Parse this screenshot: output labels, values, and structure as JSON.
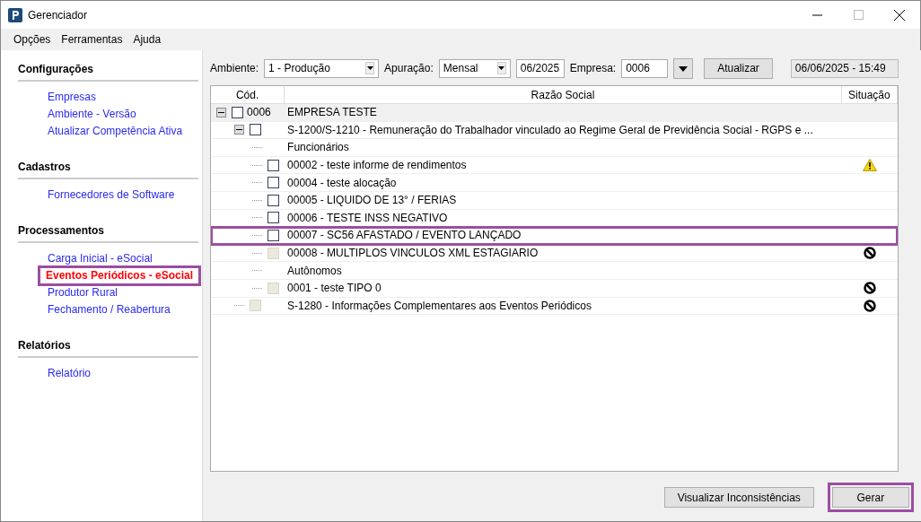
{
  "window": {
    "title": "Gerenciador"
  },
  "menu": [
    "Opções",
    "Ferramentas",
    "Ajuda"
  ],
  "sidebar": {
    "sections": [
      {
        "title": "Configurações",
        "items": [
          {
            "label": "Empresas",
            "selected": false,
            "highlighted": false
          },
          {
            "label": "Ambiente - Versão",
            "selected": false,
            "highlighted": false
          },
          {
            "label": "Atualizar Competência Ativa",
            "selected": false,
            "highlighted": false
          }
        ]
      },
      {
        "title": "Cadastros",
        "items": [
          {
            "label": "Fornecedores de Software",
            "selected": false,
            "highlighted": false
          }
        ]
      },
      {
        "title": "Processamentos",
        "items": [
          {
            "label": "Carga Inicial - eSocial",
            "selected": false,
            "highlighted": false
          },
          {
            "label": "Eventos Periódicos - eSocial",
            "selected": true,
            "highlighted": true
          },
          {
            "label": "Produtor Rural",
            "selected": false,
            "highlighted": false
          },
          {
            "label": "Fechamento / Reabertura",
            "selected": false,
            "highlighted": false
          }
        ]
      },
      {
        "title": "Relatórios",
        "items": [
          {
            "label": "Relatório",
            "selected": false,
            "highlighted": false
          }
        ]
      }
    ]
  },
  "toolbar": {
    "ambiente_label": "Ambiente:",
    "ambiente": "1 - Produção",
    "apuracao_label": "Apuração:",
    "apuracao": "Mensal",
    "periodo": "06/2025",
    "empresa_label": "Empresa:",
    "empresa": "0006",
    "refresh_button": "Atualizar",
    "timestamp": "06/06/2025 - 15:49"
  },
  "tree": {
    "columns": [
      "Cód.",
      "Razão Social",
      "Situação"
    ],
    "rows": [
      {
        "kind": "node",
        "code": "0006",
        "text": "EMPRESA TESTE",
        "checked": false,
        "disabled": false,
        "expanded": true,
        "selected": true,
        "highlighted": false,
        "warning": false,
        "blocked": false,
        "children": [
          {
            "kind": "node",
            "text": "S-1200/S-1210 - Remuneração do Trabalhador vinculado ao Regime Geral de Previdência Social - RGPS e ...",
            "checked": false,
            "disabled": false,
            "expanded": true,
            "selected": false,
            "highlighted": false,
            "warning": false,
            "blocked": false,
            "children": [
              {
                "kind": "group",
                "text": "Funcionários",
                "selected": false,
                "highlighted": false,
                "children": [
                  {
                    "kind": "node",
                    "text": "00002 - teste informe de rendimentos",
                    "checked": false,
                    "disabled": false,
                    "selected": false,
                    "highlighted": false,
                    "warning": true,
                    "blocked": false
                  },
                  {
                    "kind": "node",
                    "text": "00004 - teste alocação",
                    "checked": false,
                    "disabled": false,
                    "selected": false,
                    "highlighted": false,
                    "warning": false,
                    "blocked": false
                  },
                  {
                    "kind": "node",
                    "text": "00005 - LIQUIDO DE 13° / FERIAS",
                    "checked": false,
                    "disabled": false,
                    "selected": false,
                    "highlighted": false,
                    "warning": false,
                    "blocked": false
                  },
                  {
                    "kind": "node",
                    "text": "00006 - TESTE INSS NEGATIVO",
                    "checked": false,
                    "disabled": false,
                    "selected": false,
                    "highlighted": false,
                    "warning": false,
                    "blocked": false
                  },
                  {
                    "kind": "node",
                    "text": "00007 - SC56 AFASTADO / EVENTO LANÇADO",
                    "checked": false,
                    "disabled": false,
                    "selected": false,
                    "highlighted": true,
                    "warning": false,
                    "blocked": false
                  },
                  {
                    "kind": "node",
                    "text": "00008 - MULTIPLOS VINCULOS XML ESTAGIARIO",
                    "checked": false,
                    "disabled": true,
                    "selected": false,
                    "highlighted": false,
                    "warning": false,
                    "blocked": true
                  }
                ]
              },
              {
                "kind": "group",
                "text": "Autônomos",
                "selected": false,
                "highlighted": false,
                "children": [
                  {
                    "kind": "node",
                    "text": "0001 - teste TIPO 0",
                    "checked": false,
                    "disabled": true,
                    "selected": false,
                    "highlighted": false,
                    "warning": false,
                    "blocked": true
                  }
                ]
              }
            ]
          },
          {
            "kind": "node",
            "text": "S-1280 - Informações Complementares aos Eventos Periódicos",
            "checked": false,
            "disabled": true,
            "selected": false,
            "highlighted": false,
            "warning": false,
            "blocked": true
          }
        ]
      }
    ]
  },
  "buttons": [
    {
      "label": "Visualizar Inconsistências",
      "highlighted": false
    },
    {
      "label": "Gerar",
      "highlighted": true
    }
  ]
}
